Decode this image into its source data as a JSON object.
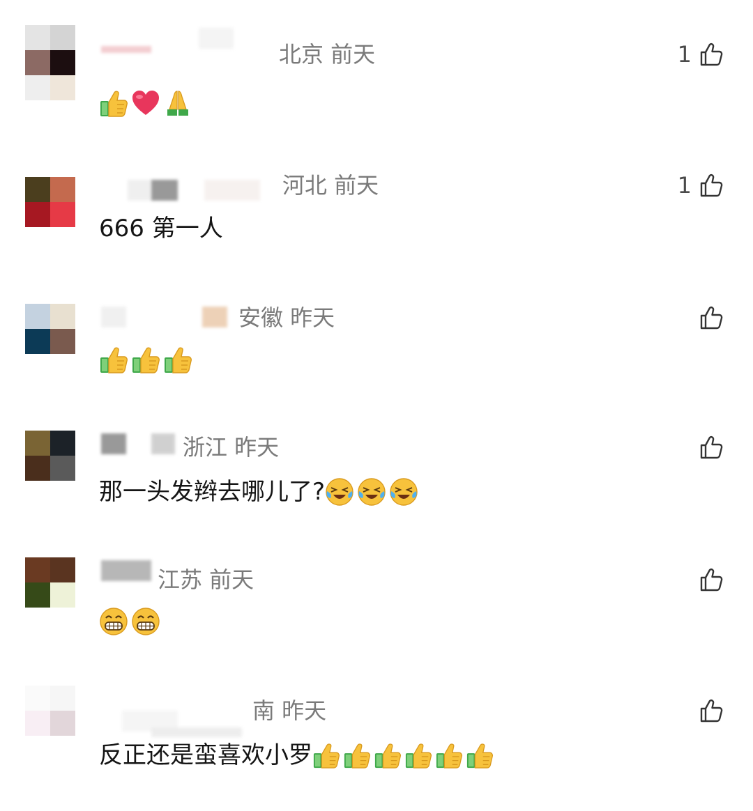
{
  "comments": [
    {
      "location_time": "北京 前天",
      "text": "",
      "emojis": [
        "thumbs-up-icon",
        "heart-icon",
        "praying-hands-icon"
      ],
      "likes": "1"
    },
    {
      "location_time": "河北 前天",
      "text": "666 第一人",
      "emojis": [],
      "likes": "1"
    },
    {
      "location_time": "安徽 昨天",
      "text": "",
      "emojis": [
        "thumbs-up-icon",
        "thumbs-up-icon",
        "thumbs-up-icon"
      ],
      "likes": ""
    },
    {
      "location_time": "浙江 昨天",
      "text": "那一头发辫去哪儿了?",
      "emojis": [
        "crying-laughing-icon",
        "crying-laughing-icon",
        "crying-laughing-icon"
      ],
      "likes": ""
    },
    {
      "location_time": "江苏 前天",
      "text": "",
      "emojis": [
        "grinning-face-icon",
        "grinning-face-icon"
      ],
      "likes": ""
    },
    {
      "location_time": "南 昨天",
      "text": "反正还是蛮喜欢小罗",
      "emojis": [
        "thumbs-up-icon",
        "thumbs-up-icon",
        "thumbs-up-icon",
        "thumbs-up-icon",
        "thumbs-up-icon",
        "thumbs-up-icon"
      ],
      "likes": ""
    }
  ],
  "colors": {
    "meta_text": "#7a7a7a",
    "body_text": "#151515",
    "like_icon": "#333333"
  }
}
